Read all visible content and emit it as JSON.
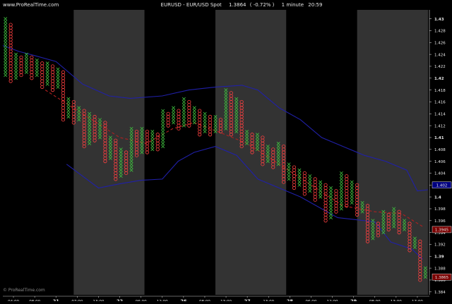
{
  "header": {
    "site": "www.ProRealTime.com",
    "title": "EURUSD - EUR/USD Spot",
    "price": "1.3864",
    "change": "( -0.72% )",
    "interval": "1 minute",
    "time": "20:59"
  },
  "watermark": "© ProRealTime.com",
  "colors": {
    "background": "#000000",
    "session_shade": "#333333",
    "x_mark": "#3fbf3f",
    "o_mark": "#ff4040",
    "band": "#2020a8",
    "trend": "#b02020",
    "axis": "#c8c8c8",
    "text": "#e8e8e8",
    "marker_blue_bg": "#000080",
    "marker_red_bg": "#7a0000"
  },
  "chart_data": {
    "type": "point-and-figure",
    "symbol": "EURUSD",
    "ylim": [
      1.3835,
      1.4315
    ],
    "y_ticks": [
      "1.384",
      "1.386",
      "1.388",
      "1.39",
      "1.392",
      "1.394",
      "1.396",
      "1.398",
      "1.4",
      "1.402",
      "1.404",
      "1.406",
      "1.408",
      "1.41",
      "1.412",
      "1.414",
      "1.416",
      "1.418",
      "1.42",
      "1.422",
      "1.424",
      "1.426",
      "1.428",
      "1.43"
    ],
    "y_ticks_major": [
      "1.39",
      "1.4",
      "1.41",
      "1.42",
      "1.43"
    ],
    "x_labels": [
      {
        "text": "04:00",
        "day": false
      },
      {
        "text": "08:00",
        "day": false
      },
      {
        "text": "21",
        "day": true
      },
      {
        "text": "07:00",
        "day": false
      },
      {
        "text": "13:00",
        "day": false
      },
      {
        "text": "22",
        "day": true
      },
      {
        "text": "06:00",
        "day": false
      },
      {
        "text": "12:00",
        "day": false
      },
      {
        "text": "26",
        "day": true
      },
      {
        "text": "08:00",
        "day": false
      },
      {
        "text": "13:00",
        "day": false
      },
      {
        "text": "27",
        "day": true
      },
      {
        "text": "13:00",
        "day": false
      },
      {
        "text": "28",
        "day": true
      },
      {
        "text": "06:00",
        "day": false
      },
      {
        "text": "12:00",
        "day": false
      },
      {
        "text": "29",
        "day": true
      },
      {
        "text": "08:00",
        "day": false
      },
      {
        "text": "13:00",
        "day": false
      },
      {
        "text": "17:00",
        "day": false
      }
    ],
    "session_shading": [
      "dark",
      "light",
      "dark",
      "light",
      "dark",
      "light"
    ],
    "upper_band": [
      {
        "x": 0,
        "y": 1.4255
      },
      {
        "x": 3,
        "y": 1.4245
      },
      {
        "x": 6,
        "y": 1.4238
      },
      {
        "x": 10,
        "y": 1.4228
      },
      {
        "x": 15,
        "y": 1.419
      },
      {
        "x": 20,
        "y": 1.417
      },
      {
        "x": 24,
        "y": 1.4166
      },
      {
        "x": 30,
        "y": 1.417
      },
      {
        "x": 35,
        "y": 1.418
      },
      {
        "x": 40,
        "y": 1.4185
      },
      {
        "x": 45,
        "y": 1.4188
      },
      {
        "x": 48,
        "y": 1.418
      },
      {
        "x": 52,
        "y": 1.415
      },
      {
        "x": 56,
        "y": 1.413
      },
      {
        "x": 60,
        "y": 1.41
      },
      {
        "x": 64,
        "y": 1.4085
      },
      {
        "x": 68,
        "y": 1.407
      },
      {
        "x": 72,
        "y": 1.406
      },
      {
        "x": 76,
        "y": 1.4045
      },
      {
        "x": 78,
        "y": 1.401
      },
      {
        "x": 80,
        "y": 1.4012
      }
    ],
    "lower_band": [
      {
        "x": 12,
        "y": 1.4055
      },
      {
        "x": 15,
        "y": 1.4035
      },
      {
        "x": 18,
        "y": 1.4015
      },
      {
        "x": 22,
        "y": 1.4022
      },
      {
        "x": 26,
        "y": 1.4028
      },
      {
        "x": 30,
        "y": 1.403
      },
      {
        "x": 33,
        "y": 1.406
      },
      {
        "x": 36,
        "y": 1.4075
      },
      {
        "x": 40,
        "y": 1.4085
      },
      {
        "x": 44,
        "y": 1.407
      },
      {
        "x": 48,
        "y": 1.403
      },
      {
        "x": 52,
        "y": 1.4015
      },
      {
        "x": 56,
        "y": 1.4
      },
      {
        "x": 60,
        "y": 1.398
      },
      {
        "x": 63,
        "y": 1.3965
      },
      {
        "x": 66,
        "y": 1.3962
      },
      {
        "x": 70,
        "y": 1.3958
      },
      {
        "x": 73,
        "y": 1.3924
      },
      {
        "x": 77,
        "y": 1.3912
      },
      {
        "x": 79,
        "y": 1.3895
      }
    ],
    "trend_line": [
      {
        "x": 8,
        "y": 1.418
      },
      {
        "x": 15,
        "y": 1.414
      },
      {
        "x": 22,
        "y": 1.41
      },
      {
        "x": 27,
        "y": 1.409
      },
      {
        "x": 32,
        "y": 1.4115
      },
      {
        "x": 36,
        "y": 1.4125
      },
      {
        "x": 41,
        "y": 1.4108
      },
      {
        "x": 46,
        "y": 1.409
      },
      {
        "x": 52,
        "y": 1.4055
      },
      {
        "x": 58,
        "y": 1.402
      },
      {
        "x": 64,
        "y": 1.3985
      },
      {
        "x": 70,
        "y": 1.3975
      },
      {
        "x": 75,
        "y": 1.3972
      },
      {
        "x": 79,
        "y": 1.395
      }
    ],
    "columns": [
      {
        "type": "X",
        "low": 1.4205,
        "high": 1.43
      },
      {
        "type": "O",
        "low": 1.4195,
        "high": 1.429
      },
      {
        "type": "X",
        "low": 1.42,
        "high": 1.424
      },
      {
        "type": "O",
        "low": 1.4205,
        "high": 1.4235
      },
      {
        "type": "X",
        "low": 1.421,
        "high": 1.424
      },
      {
        "type": "O",
        "low": 1.42,
        "high": 1.4235
      },
      {
        "type": "X",
        "low": 1.4205,
        "high": 1.423
      },
      {
        "type": "O",
        "low": 1.4185,
        "high": 1.4225
      },
      {
        "type": "X",
        "low": 1.419,
        "high": 1.4225
      },
      {
        "type": "O",
        "low": 1.418,
        "high": 1.422
      },
      {
        "type": "X",
        "low": 1.4185,
        "high": 1.4215
      },
      {
        "type": "O",
        "low": 1.413,
        "high": 1.421
      },
      {
        "type": "X",
        "low": 1.4135,
        "high": 1.4165
      },
      {
        "type": "O",
        "low": 1.4125,
        "high": 1.416
      },
      {
        "type": "X",
        "low": 1.413,
        "high": 1.415
      },
      {
        "type": "O",
        "low": 1.4085,
        "high": 1.4145
      },
      {
        "type": "X",
        "low": 1.409,
        "high": 1.414
      },
      {
        "type": "O",
        "low": 1.4095,
        "high": 1.4135
      },
      {
        "type": "X",
        "low": 1.41,
        "high": 1.413
      },
      {
        "type": "O",
        "low": 1.406,
        "high": 1.4125
      },
      {
        "type": "X",
        "low": 1.4065,
        "high": 1.41
      },
      {
        "type": "O",
        "low": 1.403,
        "high": 1.4095
      },
      {
        "type": "X",
        "low": 1.4035,
        "high": 1.408
      },
      {
        "type": "O",
        "low": 1.404,
        "high": 1.4075
      },
      {
        "type": "X",
        "low": 1.4045,
        "high": 1.4115
      },
      {
        "type": "O",
        "low": 1.407,
        "high": 1.411
      },
      {
        "type": "X",
        "low": 1.4075,
        "high": 1.4115
      },
      {
        "type": "O",
        "low": 1.4075,
        "high": 1.411
      },
      {
        "type": "X",
        "low": 1.408,
        "high": 1.411
      },
      {
        "type": "O",
        "low": 1.408,
        "high": 1.4105
      },
      {
        "type": "X",
        "low": 1.4085,
        "high": 1.4145
      },
      {
        "type": "O",
        "low": 1.412,
        "high": 1.414
      },
      {
        "type": "X",
        "low": 1.4125,
        "high": 1.415
      },
      {
        "type": "O",
        "low": 1.4115,
        "high": 1.4145
      },
      {
        "type": "X",
        "low": 1.412,
        "high": 1.4165
      },
      {
        "type": "O",
        "low": 1.412,
        "high": 1.416
      },
      {
        "type": "X",
        "low": 1.4125,
        "high": 1.415
      },
      {
        "type": "O",
        "low": 1.4105,
        "high": 1.4145
      },
      {
        "type": "X",
        "low": 1.411,
        "high": 1.414
      },
      {
        "type": "O",
        "low": 1.4105,
        "high": 1.4135
      },
      {
        "type": "X",
        "low": 1.411,
        "high": 1.4135
      },
      {
        "type": "O",
        "low": 1.411,
        "high": 1.413
      },
      {
        "type": "X",
        "low": 1.4115,
        "high": 1.418
      },
      {
        "type": "O",
        "low": 1.4105,
        "high": 1.4175
      },
      {
        "type": "X",
        "low": 1.411,
        "high": 1.4165
      },
      {
        "type": "O",
        "low": 1.4085,
        "high": 1.416
      },
      {
        "type": "X",
        "low": 1.409,
        "high": 1.411
      },
      {
        "type": "O",
        "low": 1.4075,
        "high": 1.4105
      },
      {
        "type": "X",
        "low": 1.408,
        "high": 1.4105
      },
      {
        "type": "O",
        "low": 1.4055,
        "high": 1.41
      },
      {
        "type": "X",
        "low": 1.406,
        "high": 1.4085
      },
      {
        "type": "O",
        "low": 1.405,
        "high": 1.408
      },
      {
        "type": "X",
        "low": 1.4055,
        "high": 1.409
      },
      {
        "type": "O",
        "low": 1.4025,
        "high": 1.4085
      },
      {
        "type": "X",
        "low": 1.403,
        "high": 1.4055
      },
      {
        "type": "O",
        "low": 1.4015,
        "high": 1.405
      },
      {
        "type": "X",
        "low": 1.402,
        "high": 1.4045
      },
      {
        "type": "O",
        "low": 1.4005,
        "high": 1.404
      },
      {
        "type": "X",
        "low": 1.401,
        "high": 1.4035
      },
      {
        "type": "O",
        "low": 1.3995,
        "high": 1.403
      },
      {
        "type": "X",
        "low": 1.4,
        "high": 1.4025
      },
      {
        "type": "O",
        "low": 1.396,
        "high": 1.402
      },
      {
        "type": "X",
        "low": 1.3965,
        "high": 1.4015
      },
      {
        "type": "O",
        "low": 1.3975,
        "high": 1.401
      },
      {
        "type": "X",
        "low": 1.398,
        "high": 1.404
      },
      {
        "type": "O",
        "low": 1.3985,
        "high": 1.4035
      },
      {
        "type": "X",
        "low": 1.399,
        "high": 1.4025
      },
      {
        "type": "O",
        "low": 1.397,
        "high": 1.402
      },
      {
        "type": "X",
        "low": 1.3975,
        "high": 1.399
      },
      {
        "type": "O",
        "low": 1.3925,
        "high": 1.3985
      },
      {
        "type": "X",
        "low": 1.393,
        "high": 1.396
      },
      {
        "type": "O",
        "low": 1.3935,
        "high": 1.3955
      },
      {
        "type": "X",
        "low": 1.394,
        "high": 1.3975
      },
      {
        "type": "O",
        "low": 1.3945,
        "high": 1.397
      },
      {
        "type": "X",
        "low": 1.395,
        "high": 1.398
      },
      {
        "type": "O",
        "low": 1.394,
        "high": 1.3975
      },
      {
        "type": "X",
        "low": 1.3945,
        "high": 1.396
      },
      {
        "type": "O",
        "low": 1.391,
        "high": 1.3955
      },
      {
        "type": "X",
        "low": 1.3915,
        "high": 1.393
      },
      {
        "type": "O",
        "low": 1.386,
        "high": 1.3925
      },
      {
        "type": "X",
        "low": 1.3865,
        "high": 1.388
      }
    ],
    "price_markers": [
      {
        "label": "1.402",
        "y": 1.402,
        "style": "blue"
      },
      {
        "label": "1.3945",
        "y": 1.3945,
        "style": "red"
      },
      {
        "label": "1.3865",
        "y": 1.3865,
        "style": "red"
      }
    ]
  }
}
